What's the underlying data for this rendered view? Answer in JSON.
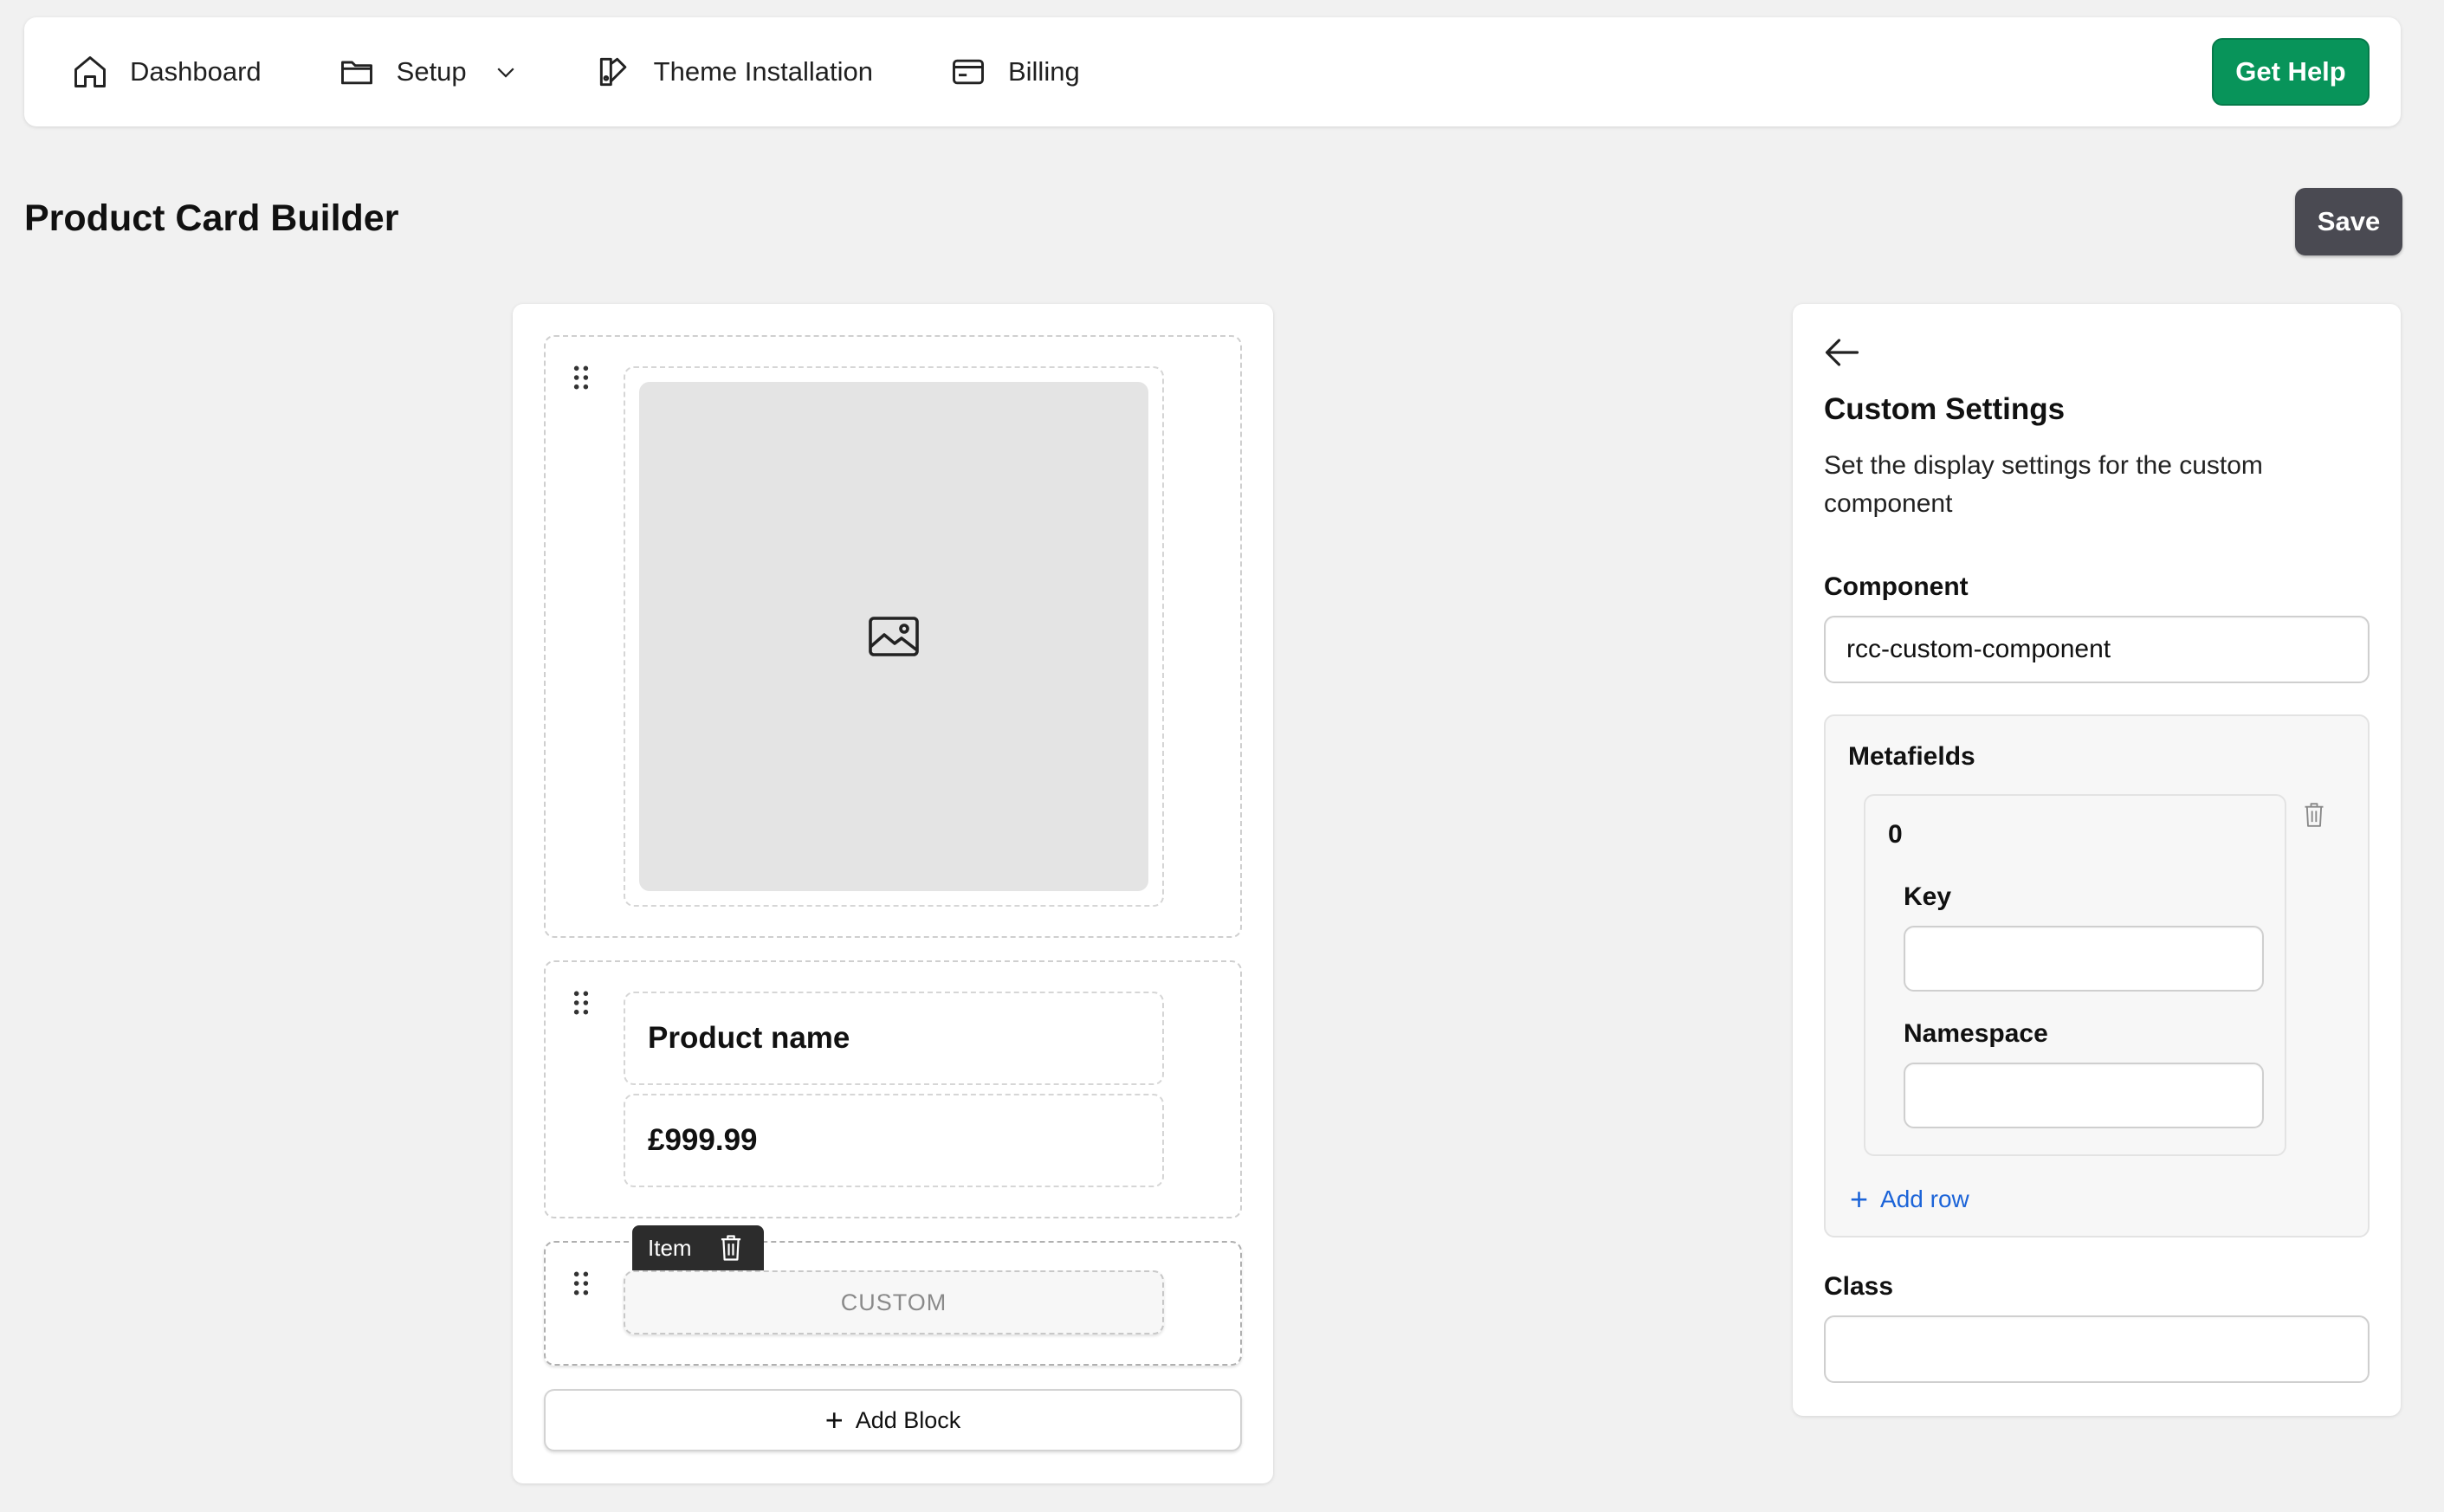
{
  "nav": {
    "items": [
      {
        "label": "Dashboard",
        "icon": "home-icon"
      },
      {
        "label": "Setup",
        "icon": "folder-icon"
      },
      {
        "label": "Theme Installation",
        "icon": "palette-icon"
      },
      {
        "label": "Billing",
        "icon": "credit-card-icon"
      }
    ],
    "get_help_label": "Get Help",
    "accent": "#08945a"
  },
  "page": {
    "title": "Product Card Builder",
    "save_label": "Save"
  },
  "builder": {
    "product_name": "Product name",
    "price": "£999.99",
    "item_tag": "Item",
    "custom_label": "CUSTOM",
    "add_block_label": "Add Block"
  },
  "settings": {
    "title": "Custom Settings",
    "description": "Set the display settings for the custom component",
    "component_label": "Component",
    "component_value": "rcc-custom-component",
    "metafields_label": "Metafields",
    "row_index": "0",
    "key_label": "Key",
    "key_value": "",
    "namespace_label": "Namespace",
    "namespace_value": "",
    "add_row_label": "Add row",
    "class_label": "Class",
    "class_value": ""
  }
}
